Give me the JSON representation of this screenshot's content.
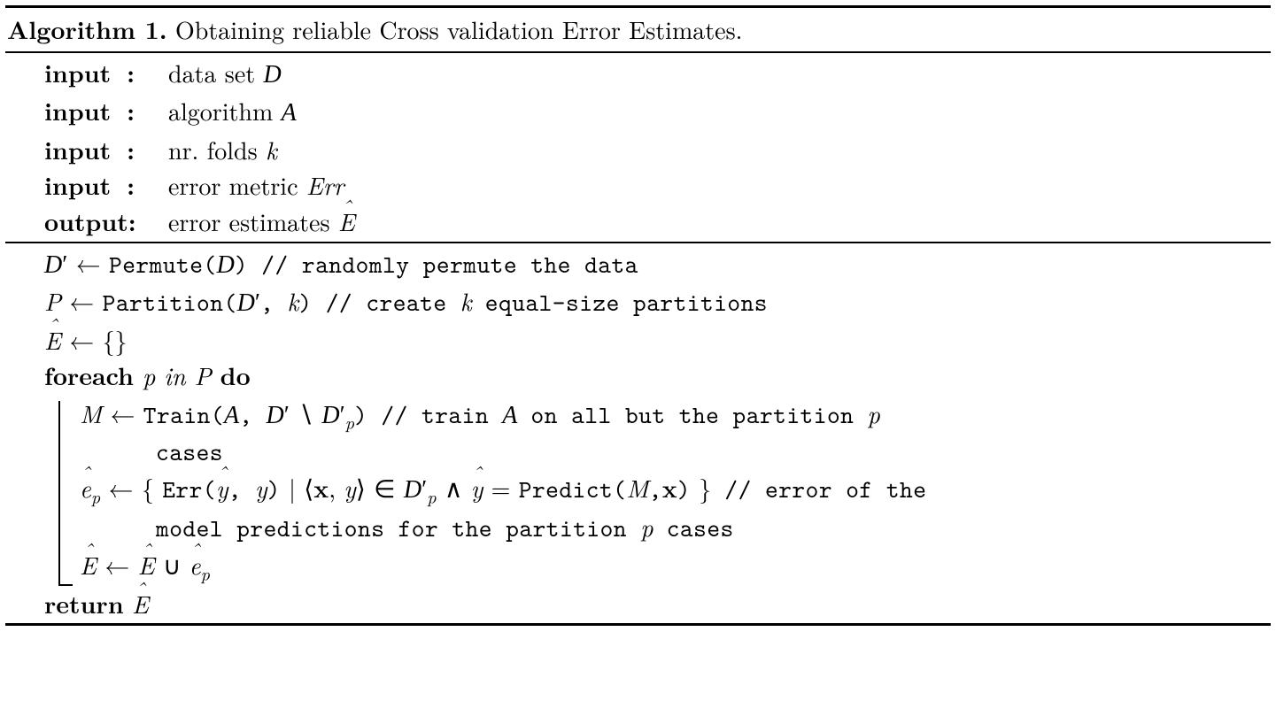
{
  "title_label": "Algorithm 1.",
  "title_text": " Obtaining reliable Cross validation Error Estimates.",
  "io": {
    "in1_label": "input",
    "in1_text": "data set ",
    "in1_sym": "D",
    "in2_label": "input",
    "in2_text": "algorithm ",
    "in2_sym": "A",
    "in3_label": "input",
    "in3_text": "nr. folds ",
    "in3_sym": "k",
    "in4_label": "input",
    "in4_text": "error metric ",
    "in4_sym": "Err",
    "out_label": "output:",
    "out_text": "error estimates ",
    "out_sym": "E"
  },
  "body": {
    "l1_lhs_D": "D",
    "l1_prime": "′",
    "l1_arrow": " ← ",
    "l1_fn": "Permute(",
    "l1_arg_D": "D",
    "l1_close": ")",
    "l1_cm": " // randomly permute the data",
    "l2_P": "P",
    "l2_arrow": " ← ",
    "l2_fn": "Partition(",
    "l2_arg_D": "D",
    "l2_prime": "′",
    "l2_comma": ", ",
    "l2_k": "k",
    "l2_close": ")",
    "l2_cm_a": " // create ",
    "l2_cm_k": "k",
    "l2_cm_b": " equal-size partitions",
    "l3_E": "E",
    "l3_rest": " ← {}",
    "l4_foreach": "foreach",
    "l4_p": " p ",
    "l4_in": "in",
    "l4_P": " P ",
    "l4_do": "do",
    "l5_M": "M",
    "l5_arrow": " ← ",
    "l5_fn": "Train(",
    "l5_A": "A",
    "l5_comma": ", ",
    "l5_D1": "D",
    "l5_prime1": "′",
    "l5_setminus": " ∖ ",
    "l5_D2": "D",
    "l5_prime2": "′",
    "l5_sub_p": "p",
    "l5_close": ")",
    "l5_cm_a": " // train ",
    "l5_cm_A": "A",
    "l5_cm_b": " on all but the partition ",
    "l5_cm_p": "p",
    "l5_cont": "cases",
    "l6_e": "e",
    "l6_sub_p": "p",
    "l6_arrow": " ← { ",
    "l6_fn": "Err(",
    "l6_yhat": "y",
    "l6_comma1": ", ",
    "l6_y": "y",
    "l6_close1": ")",
    "l6_mid": " | ⟨",
    "l6_x": "x",
    "l6_comma2": ", ",
    "l6_y2": "y",
    "l6_rangle": "⟩ ∈ ",
    "l6_D": "D",
    "l6_prime": "′",
    "l6_subp2": "p",
    "l6_wedge": "  ∧  ",
    "l6_yhat2": "y",
    "l6_eq": " = ",
    "l6_pred": "Predict(",
    "l6_M": "M",
    "l6_comma3": ",",
    "l6_x2": "x",
    "l6_close2": ")",
    "l6_brace": " }",
    "l6_cm": " // error of the",
    "l6_cont_a": "model predictions for the partition ",
    "l6_cont_p": "p",
    "l6_cont_b": " cases",
    "l7_E1": "E",
    "l7_arrow": " ← ",
    "l7_E2": "E",
    "l7_cup": " ∪ ",
    "l7_e": "e",
    "l7_sub_p": "p",
    "ret": "return",
    "ret_E": "E"
  }
}
